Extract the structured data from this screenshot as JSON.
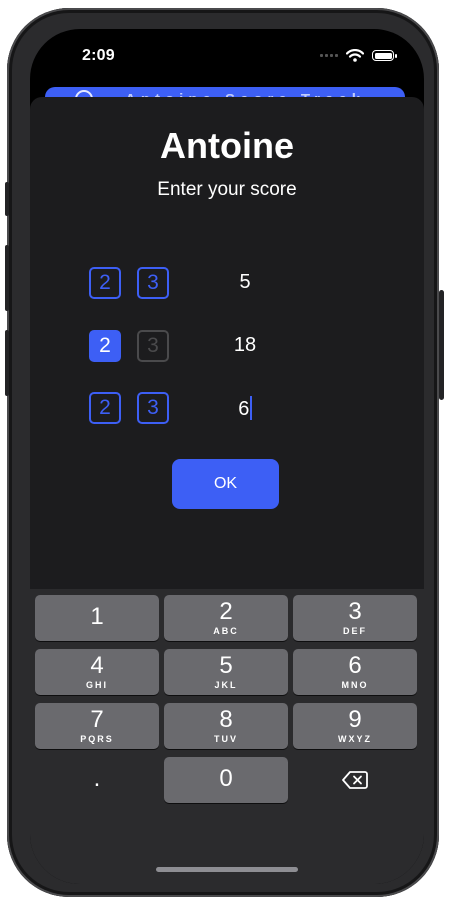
{
  "status_bar": {
    "time": "2:09",
    "wifi_icon": "wifi-icon",
    "battery_icon": "battery-icon"
  },
  "background_banner": {
    "text": "Antoine Score Track",
    "icon": "info-icon"
  },
  "dialog": {
    "title": "Antoine",
    "subtitle": "Enter your score",
    "rows": [
      {
        "chip_a": "2",
        "chip_a_state": "outline",
        "chip_b": "3",
        "chip_b_state": "outline",
        "score": "5"
      },
      {
        "chip_a": "2",
        "chip_a_state": "selected",
        "chip_b": "3",
        "chip_b_state": "disabled",
        "score": "18"
      },
      {
        "chip_a": "2",
        "chip_a_state": "outline",
        "chip_b": "3",
        "chip_b_state": "outline",
        "score": "6"
      }
    ],
    "ok_label": "OK"
  },
  "keypad": {
    "keys": [
      {
        "digit": "1",
        "letters": ""
      },
      {
        "digit": "2",
        "letters": "ABC"
      },
      {
        "digit": "3",
        "letters": "DEF"
      },
      {
        "digit": "4",
        "letters": "GHI"
      },
      {
        "digit": "5",
        "letters": "JKL"
      },
      {
        "digit": "6",
        "letters": "MNO"
      },
      {
        "digit": "7",
        "letters": "PQRS"
      },
      {
        "digit": "8",
        "letters": "TUV"
      },
      {
        "digit": "9",
        "letters": "WXYZ"
      },
      {
        "digit": ".",
        "letters": ""
      },
      {
        "digit": "0",
        "letters": ""
      },
      {
        "digit": "",
        "letters": "",
        "icon": "backspace-icon"
      }
    ]
  },
  "colors": {
    "accent": "#3d5ff5",
    "sheet": "#1c1c1e",
    "keyboard": "#2b2b2d",
    "key": "#6a6a6e"
  }
}
